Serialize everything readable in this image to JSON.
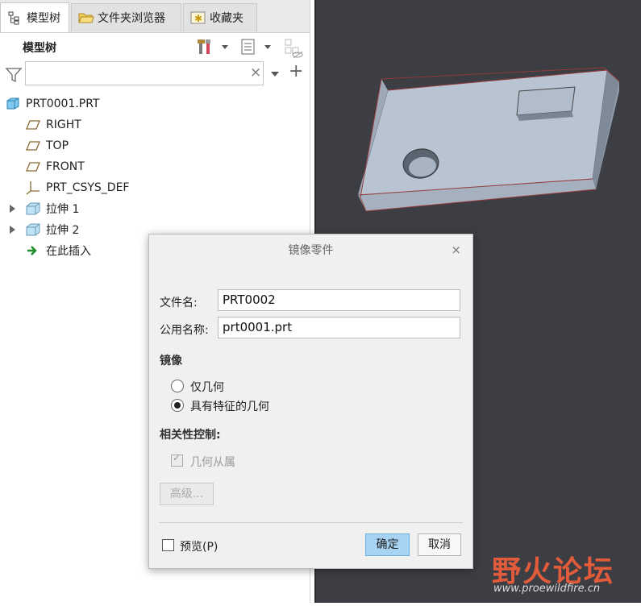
{
  "tabs": [
    {
      "label": "模型树",
      "active": true
    },
    {
      "label": "文件夹浏览器",
      "active": false
    },
    {
      "label": "收藏夹",
      "active": false
    }
  ],
  "tree_panel": {
    "title": "模型树",
    "search": {
      "value": "",
      "placeholder": ""
    },
    "clear_glyph": "×",
    "add_glyph": "+"
  },
  "tree": {
    "root": "PRT0001.PRT",
    "items": [
      {
        "label": "RIGHT",
        "icon": "datum-plane-icon"
      },
      {
        "label": "TOP",
        "icon": "datum-plane-icon"
      },
      {
        "label": "FRONT",
        "icon": "datum-plane-icon"
      },
      {
        "label": "PRT_CSYS_DEF",
        "icon": "csys-icon"
      },
      {
        "label": "拉伸 1",
        "icon": "extrude-icon",
        "expandable": true
      },
      {
        "label": "拉伸 2",
        "icon": "extrude-icon",
        "expandable": true
      },
      {
        "label": "在此插入",
        "icon": "insert-arrow-icon"
      }
    ]
  },
  "dialog": {
    "title": "镜像零件",
    "close_glyph": "×",
    "file_name_label": "文件名:",
    "file_name_value": "PRT0002",
    "common_name_label": "公用名称:",
    "common_name_value": "prt0001.prt",
    "mirror_section": "镜像",
    "radio_geometry_only": "仅几何",
    "radio_with_features": "具有特征的几何",
    "selected_radio": "radio_with_features",
    "dependency_section": "相关性控制:",
    "geometry_dependent": "几何从属",
    "geometry_dependent_checked": true,
    "advanced_button": "高级...",
    "preview_label": "预览(P)",
    "preview_checked": false,
    "ok_button": "确定",
    "cancel_button": "取消"
  },
  "watermark": {
    "logo_text": "野火论坛",
    "url": "www.proewildfire.cn"
  },
  "colors": {
    "viewport_bg": "#3c3e43",
    "part_face": "#b9c4d2",
    "primary_button": "#a6d4f2",
    "watermark": "#e25b3b"
  }
}
